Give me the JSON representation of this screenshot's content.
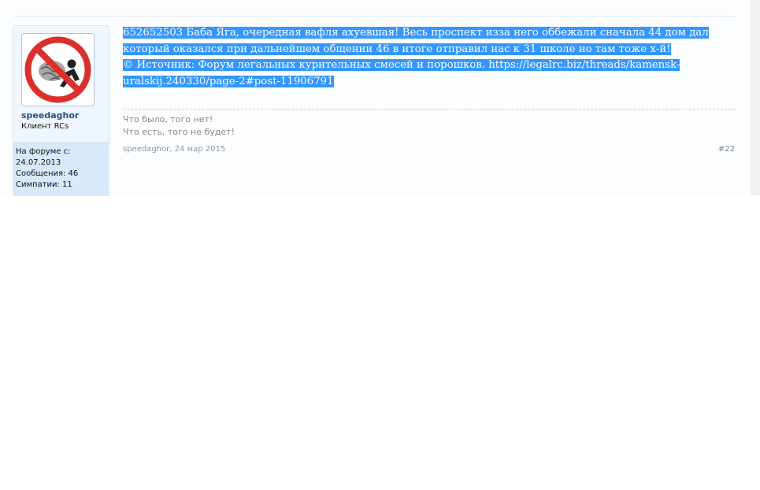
{
  "post": {
    "message_lines": [
      "652652503 Баба Яга, очередная вафля ахуевшая! Весь проспект изза него оббежали сначала 44 дом дал",
      "который оказался при дальнейшем общении 46 в итоге отправил нас к 31 школе но там тоже х-й!",
      "© Источник: Форум легальных курительных смесей и порошков. https://legalrc.biz/threads/kamensk-",
      "uralskij.240330/page-2#post-11906791"
    ],
    "signature_lines": [
      "Что было, того нет!",
      "Что есть, того не будет!"
    ],
    "author_link": "speedaghor",
    "date": "24 мар 2015",
    "post_number": "#22"
  },
  "user": {
    "name": "speedaghor",
    "title": "Клиент RCs",
    "avatar_icon": "no-smoking-brain-icon",
    "stats": {
      "joined_label": "На форуме с:",
      "joined_value": "24.07.2013",
      "messages": "Сообщения: 46",
      "likes": "Симпатии: 11"
    }
  },
  "colors": {
    "selection": "#3397ff",
    "sidebar_bg": "#eff6fd",
    "stats_bg": "#d7e9fb",
    "username": "#245287"
  }
}
